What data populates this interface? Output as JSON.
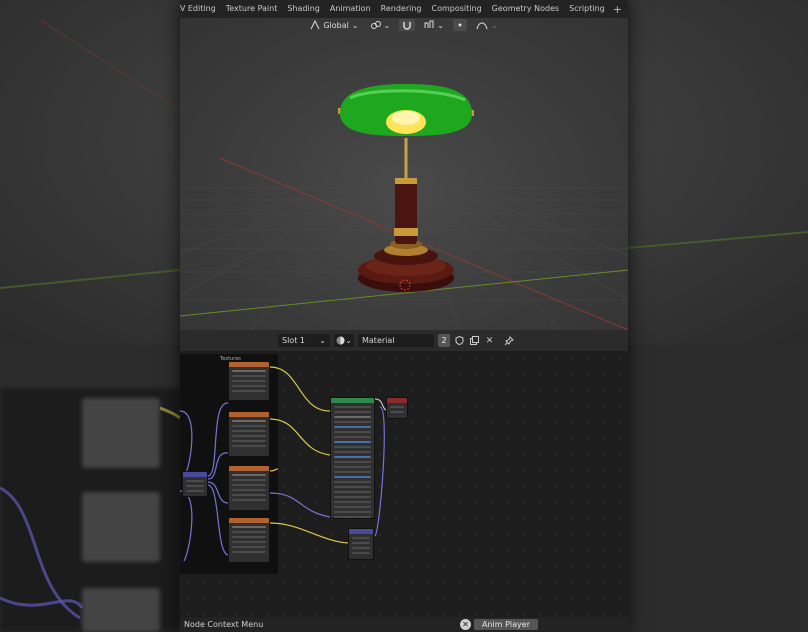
{
  "workspace_tabs": [
    "UV Editing",
    "Texture Paint",
    "Shading",
    "Animation",
    "Rendering",
    "Compositing",
    "Geometry Nodes",
    "Scripting"
  ],
  "add_tab_label": "+",
  "viewport_header": {
    "orientation_label": "Global",
    "snap_icon": "magnet-icon",
    "proportional_icon": "proportional-falloff-icon"
  },
  "node_header": {
    "slot_label": "Slot 1",
    "material_name": "Material",
    "user_count": "2"
  },
  "node_editor": {
    "frame_label": "Textures"
  },
  "status_bar": {
    "context_menu": "Node Context Menu",
    "anim_player": "Anim Player"
  },
  "colors": {
    "lamp_shade": "#1fa81f",
    "lamp_glow": "#ffe45a",
    "lamp_wood": "#5a1a12",
    "lamp_brass": "#c89a3a",
    "header_texture_node": "#b4622d",
    "header_shader_node": "#2f8a4a",
    "header_output_node": "#8a2a2a",
    "header_vector_node": "#4a4a9a",
    "wire_yellow": "#d6c84a",
    "wire_purple": "#7a72d6"
  }
}
